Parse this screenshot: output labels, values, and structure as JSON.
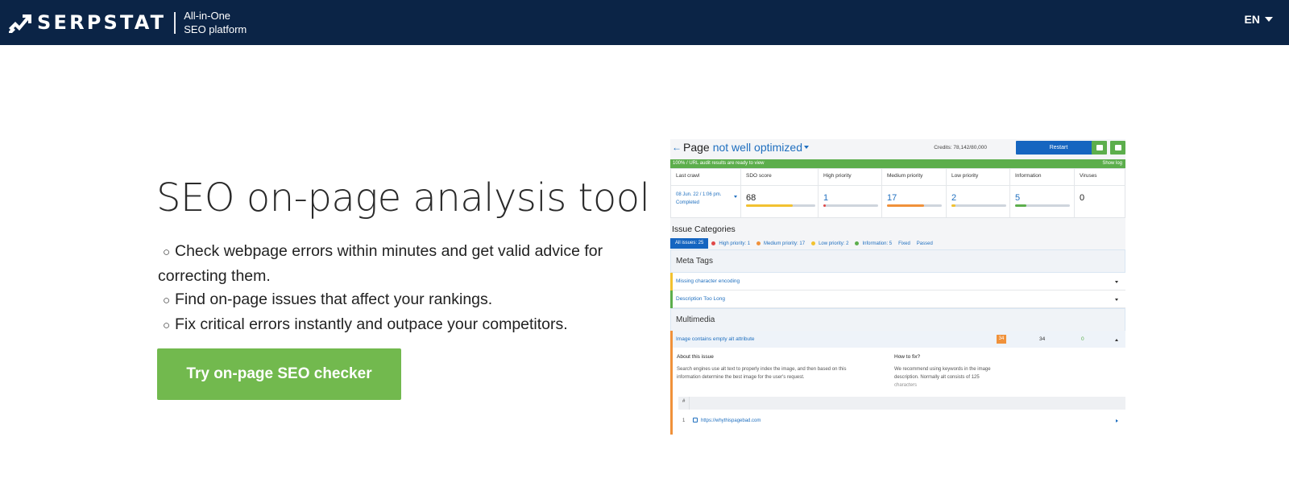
{
  "header": {
    "logo_text": "SERPSTAT",
    "tagline_line1": "All-in-One",
    "tagline_line2": "SEO platform",
    "language": "EN"
  },
  "hero": {
    "title": "SEO on-page analysis tool",
    "bullet_glyph": "○",
    "bullets": [
      "Check webpage errors within minutes and get valid advice for correcting them.",
      "Find on-page issues that affect your rankings.",
      "Fix critical errors instantly and outpace your competitors."
    ],
    "cta_label": "Try on-page SEO checker"
  },
  "mock": {
    "title_prefix": "Page",
    "title_accent": "not well optimized",
    "credits": "Credits: 78,142/80,000",
    "restart_label": "Restart",
    "audit_banner": "100% / URL audit results are ready to view",
    "show_log": "Show log",
    "stats": {
      "last_crawl_label": "Last crawl",
      "last_crawl_date": "08 Jun. 22 / 1:06 pm.",
      "last_crawl_status": "Completed",
      "sdo_label": "SDO score",
      "sdo_value": "68",
      "high_label": "High priority",
      "high_value": "1",
      "medium_label": "Medium priority",
      "medium_value": "17",
      "low_label": "Low priority",
      "low_value": "2",
      "info_label": "Information",
      "info_value": "5",
      "viruses_label": "Viruses",
      "viruses_value": "0"
    },
    "issue_categories_title": "Issue Categories",
    "filters": {
      "all": "All issues: 25",
      "high": "High priority: 1",
      "medium": "Medium priority: 17",
      "low": "Low priority: 2",
      "info": "Information: 5",
      "fixed": "Fixed",
      "passed": "Passed"
    },
    "meta_tags_title": "Meta Tags",
    "meta_rows": [
      "Missing character encoding",
      "Description Too Long"
    ],
    "multimedia_title": "Multimedia",
    "multimedia_row": "Image contains empty alt attribute",
    "multimedia_counts": [
      "34",
      "34",
      "0"
    ],
    "about_title": "About this issue",
    "about_text": "Search engines use alt text to properly index the image, and then based on this information determine the best image for the user's request.",
    "howfix_title": "How to fix?",
    "howfix_text": "We recommend using keywords in the image description. Normally alt consists of 125 characters",
    "table_hash": "#",
    "row_number": "1",
    "row_url": "https://whythispagebad.com"
  },
  "colors": {
    "header_bg": "#0b2446",
    "cta_green": "#72b94e",
    "accent_blue": "#1f6fbf",
    "high": "#e04848",
    "medium": "#f0913a",
    "low": "#f2c230",
    "info": "#5cae4c"
  },
  "progress": {
    "sdo": 0.68,
    "high": 0.04,
    "medium": 0.68,
    "low": 0.08,
    "info": 0.2
  }
}
